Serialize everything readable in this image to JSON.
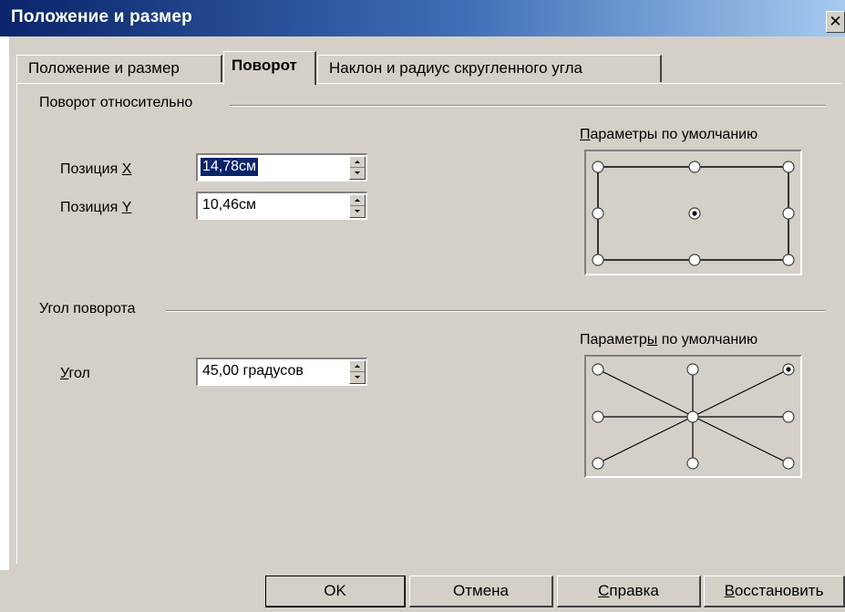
{
  "window": {
    "title": "Положение и размер",
    "close_glyph": "✕"
  },
  "tabs": [
    {
      "label": "Положение и размер"
    },
    {
      "label": "Поворот"
    },
    {
      "label": "Наклон и радиус скругленного угла"
    }
  ],
  "pivot": {
    "title": "Поворот относительно",
    "x_label_prefix": "Позиция ",
    "x_label_key": "X",
    "x_value": "14,78см",
    "y_label_prefix": "Позиция ",
    "y_label_key": "Y",
    "y_value": "10,46см",
    "defaults_label_key": "П",
    "defaults_label_rest": "араметры по умолчанию",
    "selected_point": "center"
  },
  "angle": {
    "title": "Угол поворота",
    "label_key": "У",
    "label_rest": "гол",
    "value": "45,00 градусов",
    "defaults_label_start": "Параметр",
    "defaults_label_key": "ы",
    "defaults_label_end": " по умолчанию",
    "selected_point": "top-right"
  },
  "buttons": {
    "ok": "OK",
    "cancel": "Отмена",
    "help_key": "С",
    "help_rest": "правка",
    "reset_key": "В",
    "reset_rest": "осстановить"
  },
  "colors": {
    "title_start": "#0a246a",
    "title_end": "#a6caf0",
    "face": "#d4d0c8",
    "selection": "#0a246a"
  }
}
